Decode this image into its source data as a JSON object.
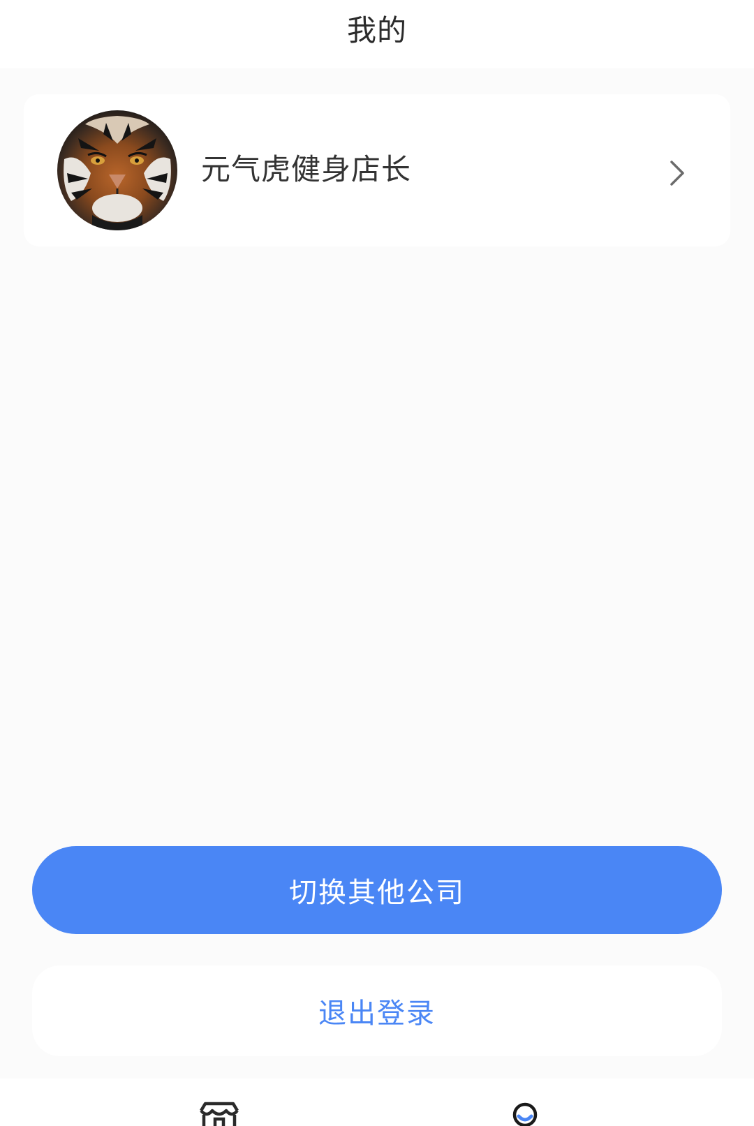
{
  "header": {
    "title": "我的"
  },
  "profile": {
    "name": "元气虎健身店长",
    "avatar_icon": "tiger-avatar",
    "chevron_icon": "chevron-right-icon"
  },
  "actions": {
    "switch_company_label": "切换其他公司",
    "logout_label": "退出登录"
  },
  "tab_bar": {
    "items": [
      {
        "icon": "store-icon",
        "active": false
      },
      {
        "icon": "user-icon",
        "active": true
      }
    ]
  },
  "colors": {
    "background": "#fbfbfb",
    "card": "#ffffff",
    "accent": "#4a86f5",
    "text_primary": "#333333",
    "chevron": "#6b6b6b"
  }
}
